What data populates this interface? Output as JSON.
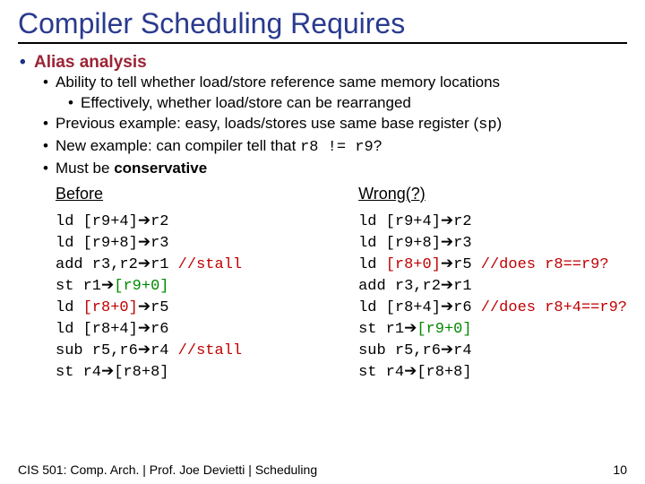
{
  "title": "Compiler Scheduling Requires",
  "bullets": {
    "main": "Alias analysis",
    "b1": "Ability to tell whether load/store reference same memory locations",
    "b1a": "Effectively, whether load/store can be rearranged",
    "b2_pre": "Previous example: easy, loads/stores use same base register (",
    "b2_code": "sp",
    "b2_post": ")",
    "b3_pre": "New example: can compiler tell that ",
    "b3_code": "r8 != r9",
    "b3_post": "?",
    "b4_pre": "Must be ",
    "b4_bold": "conservative"
  },
  "cols": {
    "left_head": "Before",
    "right_head": "Wrong(?)"
  },
  "left": {
    "l1a": "ld [r9+4]",
    "l1b": "r2",
    "l2a": "ld [r9+8]",
    "l2b": "r3",
    "l3a": "add r3,r2",
    "l3b": "r1",
    "l3c": " //stall",
    "l4a": "st r1",
    "l4b": "[r9+0]",
    "l5a": "ld ",
    "l5r": "[r8+0]",
    "l5b": "r5",
    "l6a": "ld [r8+4]",
    "l6b": "r6",
    "l7a": "sub r5,r6",
    "l7b": "r4",
    "l7c": " //stall",
    "l8a": "st r4",
    "l8b": "[r8+8]"
  },
  "right": {
    "l1a": "ld [r9+4]",
    "l1b": "r2",
    "l2a": "ld [r9+8]",
    "l2b": "r3",
    "l3a": "ld ",
    "l3r": "[r8+0]",
    "l3b": "r5",
    "l3c": " //does r8==r9?",
    "l4a": "add r3,r2",
    "l4b": "r1",
    "l5a": "ld [r8+4]",
    "l5b": "r6",
    "l5c": " //does r8+4==r9?",
    "l6a": "st r1",
    "l6b": "[r9+0]",
    "l7a": "sub r5,r6",
    "l7b": "r4",
    "l8a": "st r4",
    "l8b": "[r8+8]"
  },
  "footer": {
    "left": "CIS 501: Comp. Arch.  |  Prof. Joe Devietti  |  Scheduling",
    "right": "10"
  },
  "chart_data": {
    "type": "table",
    "title": "Compiler Scheduling Requires — Alias analysis",
    "series": [
      {
        "name": "Before",
        "values": [
          "ld [r9+4]→r2",
          "ld [r9+8]→r3",
          "add r3,r2→r1 //stall",
          "st r1→[r9+0]",
          "ld [r8+0]→r5",
          "ld [r8+4]→r6",
          "sub r5,r6→r4 //stall",
          "st r4→[r8+8]"
        ]
      },
      {
        "name": "Wrong(?)",
        "values": [
          "ld [r9+4]→r2",
          "ld [r9+8]→r3",
          "ld [r8+0]→r5 //does r8==r9?",
          "add r3,r2→r1",
          "ld [r8+4]→r6 //does r8+4==r9?",
          "st r1→[r9+0]",
          "sub r5,r6→r4",
          "st r4→[r8+8]"
        ]
      }
    ]
  }
}
